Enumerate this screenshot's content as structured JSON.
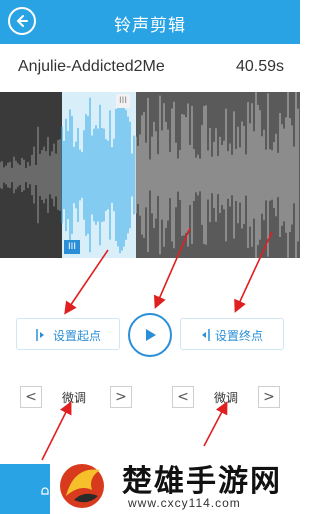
{
  "header": {
    "title": "铃声剪辑",
    "back_icon": "back-icon"
  },
  "song": {
    "name": "Anjulie-Addicted2Me",
    "duration": "40.59s"
  },
  "editor": {
    "start_handle_label": "III",
    "end_handle_label": "III"
  },
  "controls": {
    "set_start_label": "设置起点",
    "set_end_label": "设置终点",
    "play_icon": "play-icon",
    "fine_tune_left_label": "微调",
    "fine_tune_right_label": "微调",
    "prev_arrow": "<",
    "next_arrow": ">"
  },
  "watermark": {
    "title": "楚雄手游网",
    "url": "www.cxcy114.com"
  },
  "colors": {
    "accent": "#2aa3e4",
    "annotation": "#e02020",
    "waveform_selected": "#2fa8ec"
  }
}
